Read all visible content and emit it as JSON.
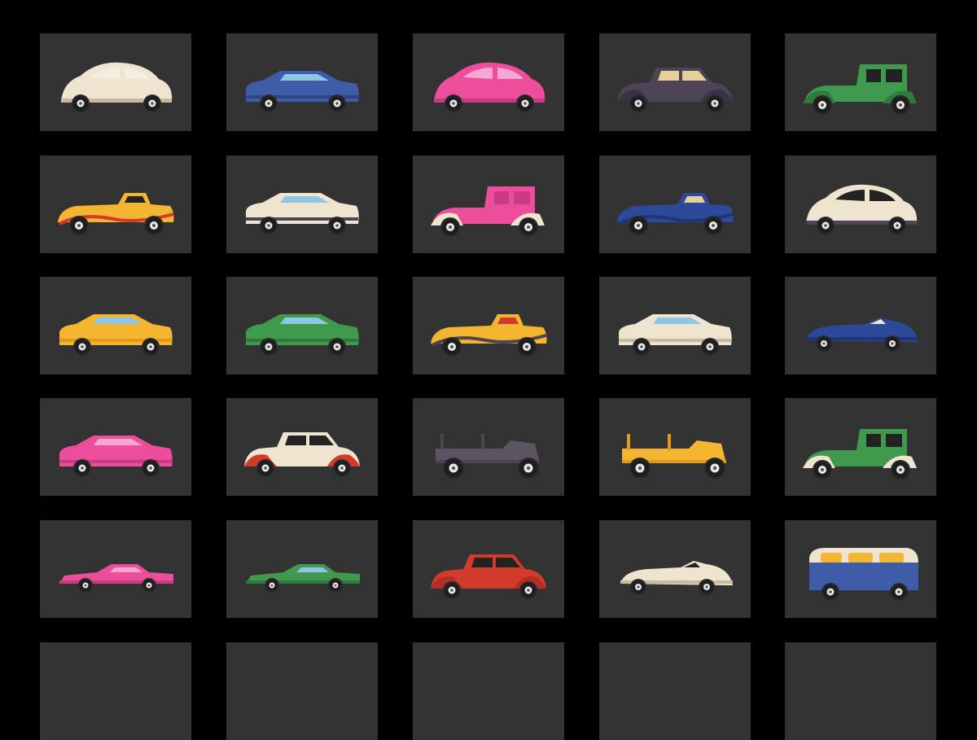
{
  "background": "#000000",
  "tile_color": "#333333",
  "rows": [
    [
      {
        "name": "beetle-car-cream",
        "body": "#efe4cf",
        "accent": "#c8baa0",
        "glass": "#f4eee0",
        "style": "beetle"
      },
      {
        "name": "muscle-car-blue",
        "body": "#3f5ca8",
        "accent": "#2e4585",
        "glass": "#8fc6e6",
        "style": "coupe"
      },
      {
        "name": "beetle-car-pink",
        "body": "#ec4e9c",
        "accent": "#c93b82",
        "glass": "#f7a7cf",
        "style": "beetle"
      },
      {
        "name": "classic-sedan-purple",
        "body": "#4e4457",
        "accent": "#3b3344",
        "glass": "#e7cf9c",
        "style": "classic"
      },
      {
        "name": "vintage-limousine-green",
        "body": "#3f9a4d",
        "accent": "#2f7a3c",
        "glass": "#222222",
        "style": "vintage"
      }
    ],
    [
      {
        "name": "roadster-yellow-red",
        "body": "#f4b630",
        "accent": "#d23a2c",
        "glass": "#222222",
        "style": "roadster"
      },
      {
        "name": "coupe-cream-purple",
        "body": "#efe4cf",
        "accent": "#4e4457",
        "glass": "#8fc6e6",
        "style": "coupe"
      },
      {
        "name": "vintage-truck-pink",
        "body": "#ec4e9c",
        "accent": "#efe4cf",
        "glass": "#c93b82",
        "style": "vintage"
      },
      {
        "name": "sports-roadster-blue",
        "body": "#2d4a9a",
        "accent": "#1f3577",
        "glass": "#e7cf9c",
        "style": "roadster"
      },
      {
        "name": "streamliner-cream-purple",
        "body": "#efe4cf",
        "accent": "#4e4457",
        "glass": "#222222",
        "style": "beetle"
      }
    ],
    [
      {
        "name": "muscle-car-yellow",
        "body": "#f4b630",
        "accent": "#e09a1f",
        "glass": "#8fc6e6",
        "style": "coupe"
      },
      {
        "name": "muscle-car-green",
        "body": "#3f9a4d",
        "accent": "#2f7a3c",
        "glass": "#8fc6e6",
        "style": "coupe"
      },
      {
        "name": "roadster-yellow-purple",
        "body": "#f4b630",
        "accent": "#4e4457",
        "glass": "#d23a2c",
        "style": "roadster"
      },
      {
        "name": "sports-car-cream",
        "body": "#efe4cf",
        "accent": "#c8baa0",
        "glass": "#8fc6e6",
        "style": "coupe"
      },
      {
        "name": "race-car-blue",
        "body": "#2d4a9a",
        "accent": "#1f3577",
        "glass": "#efe4cf",
        "style": "racer"
      }
    ],
    [
      {
        "name": "gt-car-pink",
        "body": "#ec4e9c",
        "accent": "#c93b82",
        "glass": "#f7a7cf",
        "style": "coupe"
      },
      {
        "name": "classic-coupe-cream-red",
        "body": "#efe4cf",
        "accent": "#d23a2c",
        "glass": "#222222",
        "style": "classic"
      },
      {
        "name": "antique-car-purple",
        "body": "#5d5463",
        "accent": "#4e4457",
        "glass": "#222222",
        "style": "antique"
      },
      {
        "name": "antique-car-yellow",
        "body": "#f4b630",
        "accent": "#e09a1f",
        "glass": "#222222",
        "style": "antique"
      },
      {
        "name": "vintage-car-green-cream",
        "body": "#3f9a4d",
        "accent": "#efe4cf",
        "glass": "#222222",
        "style": "vintage"
      }
    ],
    [
      {
        "name": "cadillac-pink",
        "body": "#ec4e9c",
        "accent": "#c93b82",
        "glass": "#f7a7cf",
        "style": "lowrider"
      },
      {
        "name": "lowrider-green",
        "body": "#3f9a4d",
        "accent": "#2f7a3c",
        "glass": "#8fc6e6",
        "style": "lowrider"
      },
      {
        "name": "sedan-red",
        "body": "#d23a2c",
        "accent": "#b22e22",
        "glass": "#222222",
        "style": "classic"
      },
      {
        "name": "race-car-cream",
        "body": "#efe4cf",
        "accent": "#c8baa0",
        "glass": "#222222",
        "style": "racer"
      },
      {
        "name": "van-blue",
        "body": "#3f5ca8",
        "accent": "#efe4cf",
        "glass": "#f4b630",
        "style": "van"
      }
    ],
    [
      {
        "name": "car-tile-row6-1",
        "body": "#333333",
        "accent": "#333333",
        "glass": "#333333",
        "style": "none"
      },
      {
        "name": "car-tile-row6-2",
        "body": "#333333",
        "accent": "#333333",
        "glass": "#333333",
        "style": "none"
      },
      {
        "name": "car-tile-row6-3",
        "body": "#333333",
        "accent": "#333333",
        "glass": "#333333",
        "style": "none"
      },
      {
        "name": "car-tile-row6-4",
        "body": "#333333",
        "accent": "#333333",
        "glass": "#333333",
        "style": "none"
      },
      {
        "name": "car-tile-row6-5",
        "body": "#333333",
        "accent": "#333333",
        "glass": "#333333",
        "style": "none"
      }
    ]
  ]
}
